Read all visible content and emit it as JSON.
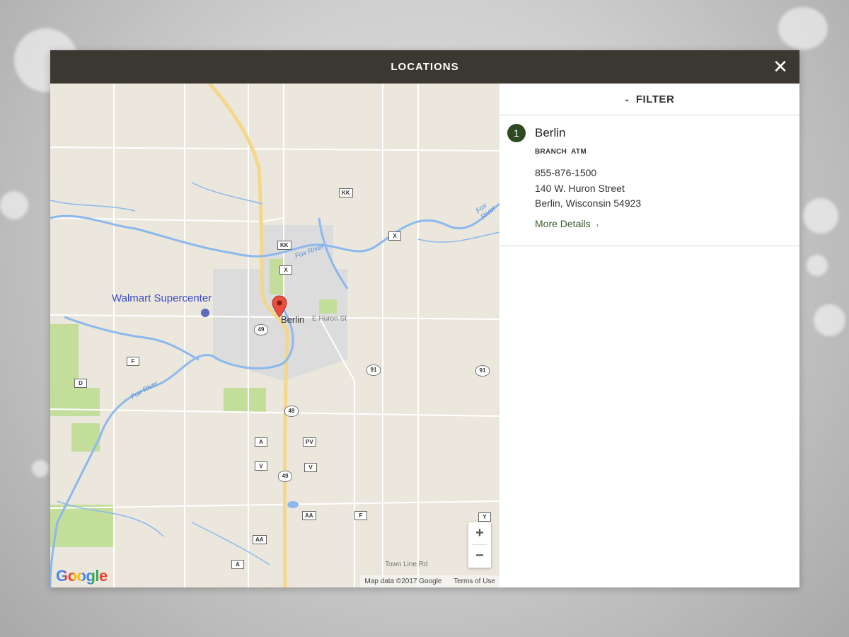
{
  "header": {
    "title": "LOCATIONS",
    "close_glyph": "✕"
  },
  "map": {
    "poi": "Walmart Supercenter",
    "city": "Berlin",
    "street": "E Huron St",
    "river_labels": [
      "Fox River",
      "Fox River",
      "Fox River"
    ],
    "road_townline": "Town Line Rd",
    "shields": [
      "KK",
      "X",
      "KK",
      "X",
      "F",
      "D",
      "A",
      "PV",
      "V",
      "V",
      "AA",
      "F",
      "Y",
      "AA",
      "A"
    ],
    "highways": [
      "49",
      "91",
      "91",
      "49",
      "49"
    ],
    "zoom_in": "+",
    "zoom_out": "−",
    "logo": "Google",
    "attribution": {
      "map_data": "Map data ©2017 Google",
      "terms": "Terms of Use"
    },
    "colors": {
      "land": "#ebe7dc",
      "water": "#8cb8ee",
      "park": "#c3dd9b",
      "urban": "#dcdcdc",
      "highway": "#f4d78a",
      "pin": "#e94e3d"
    }
  },
  "filter": {
    "label": "FILTER",
    "chevron": "⌄"
  },
  "locations": [
    {
      "number": "1",
      "name": "Berlin",
      "tags": [
        "BRANCH",
        "ATM"
      ],
      "phone": "855-876-1500",
      "street": "140 W. Huron Street",
      "city_state_zip": "Berlin, Wisconsin 54923",
      "more_label": "More Details",
      "more_chevron": "›"
    }
  ],
  "colors": {
    "header_bg": "#3b3731",
    "accent_green": "#2f4a22",
    "link_green": "#3c5a2a"
  }
}
